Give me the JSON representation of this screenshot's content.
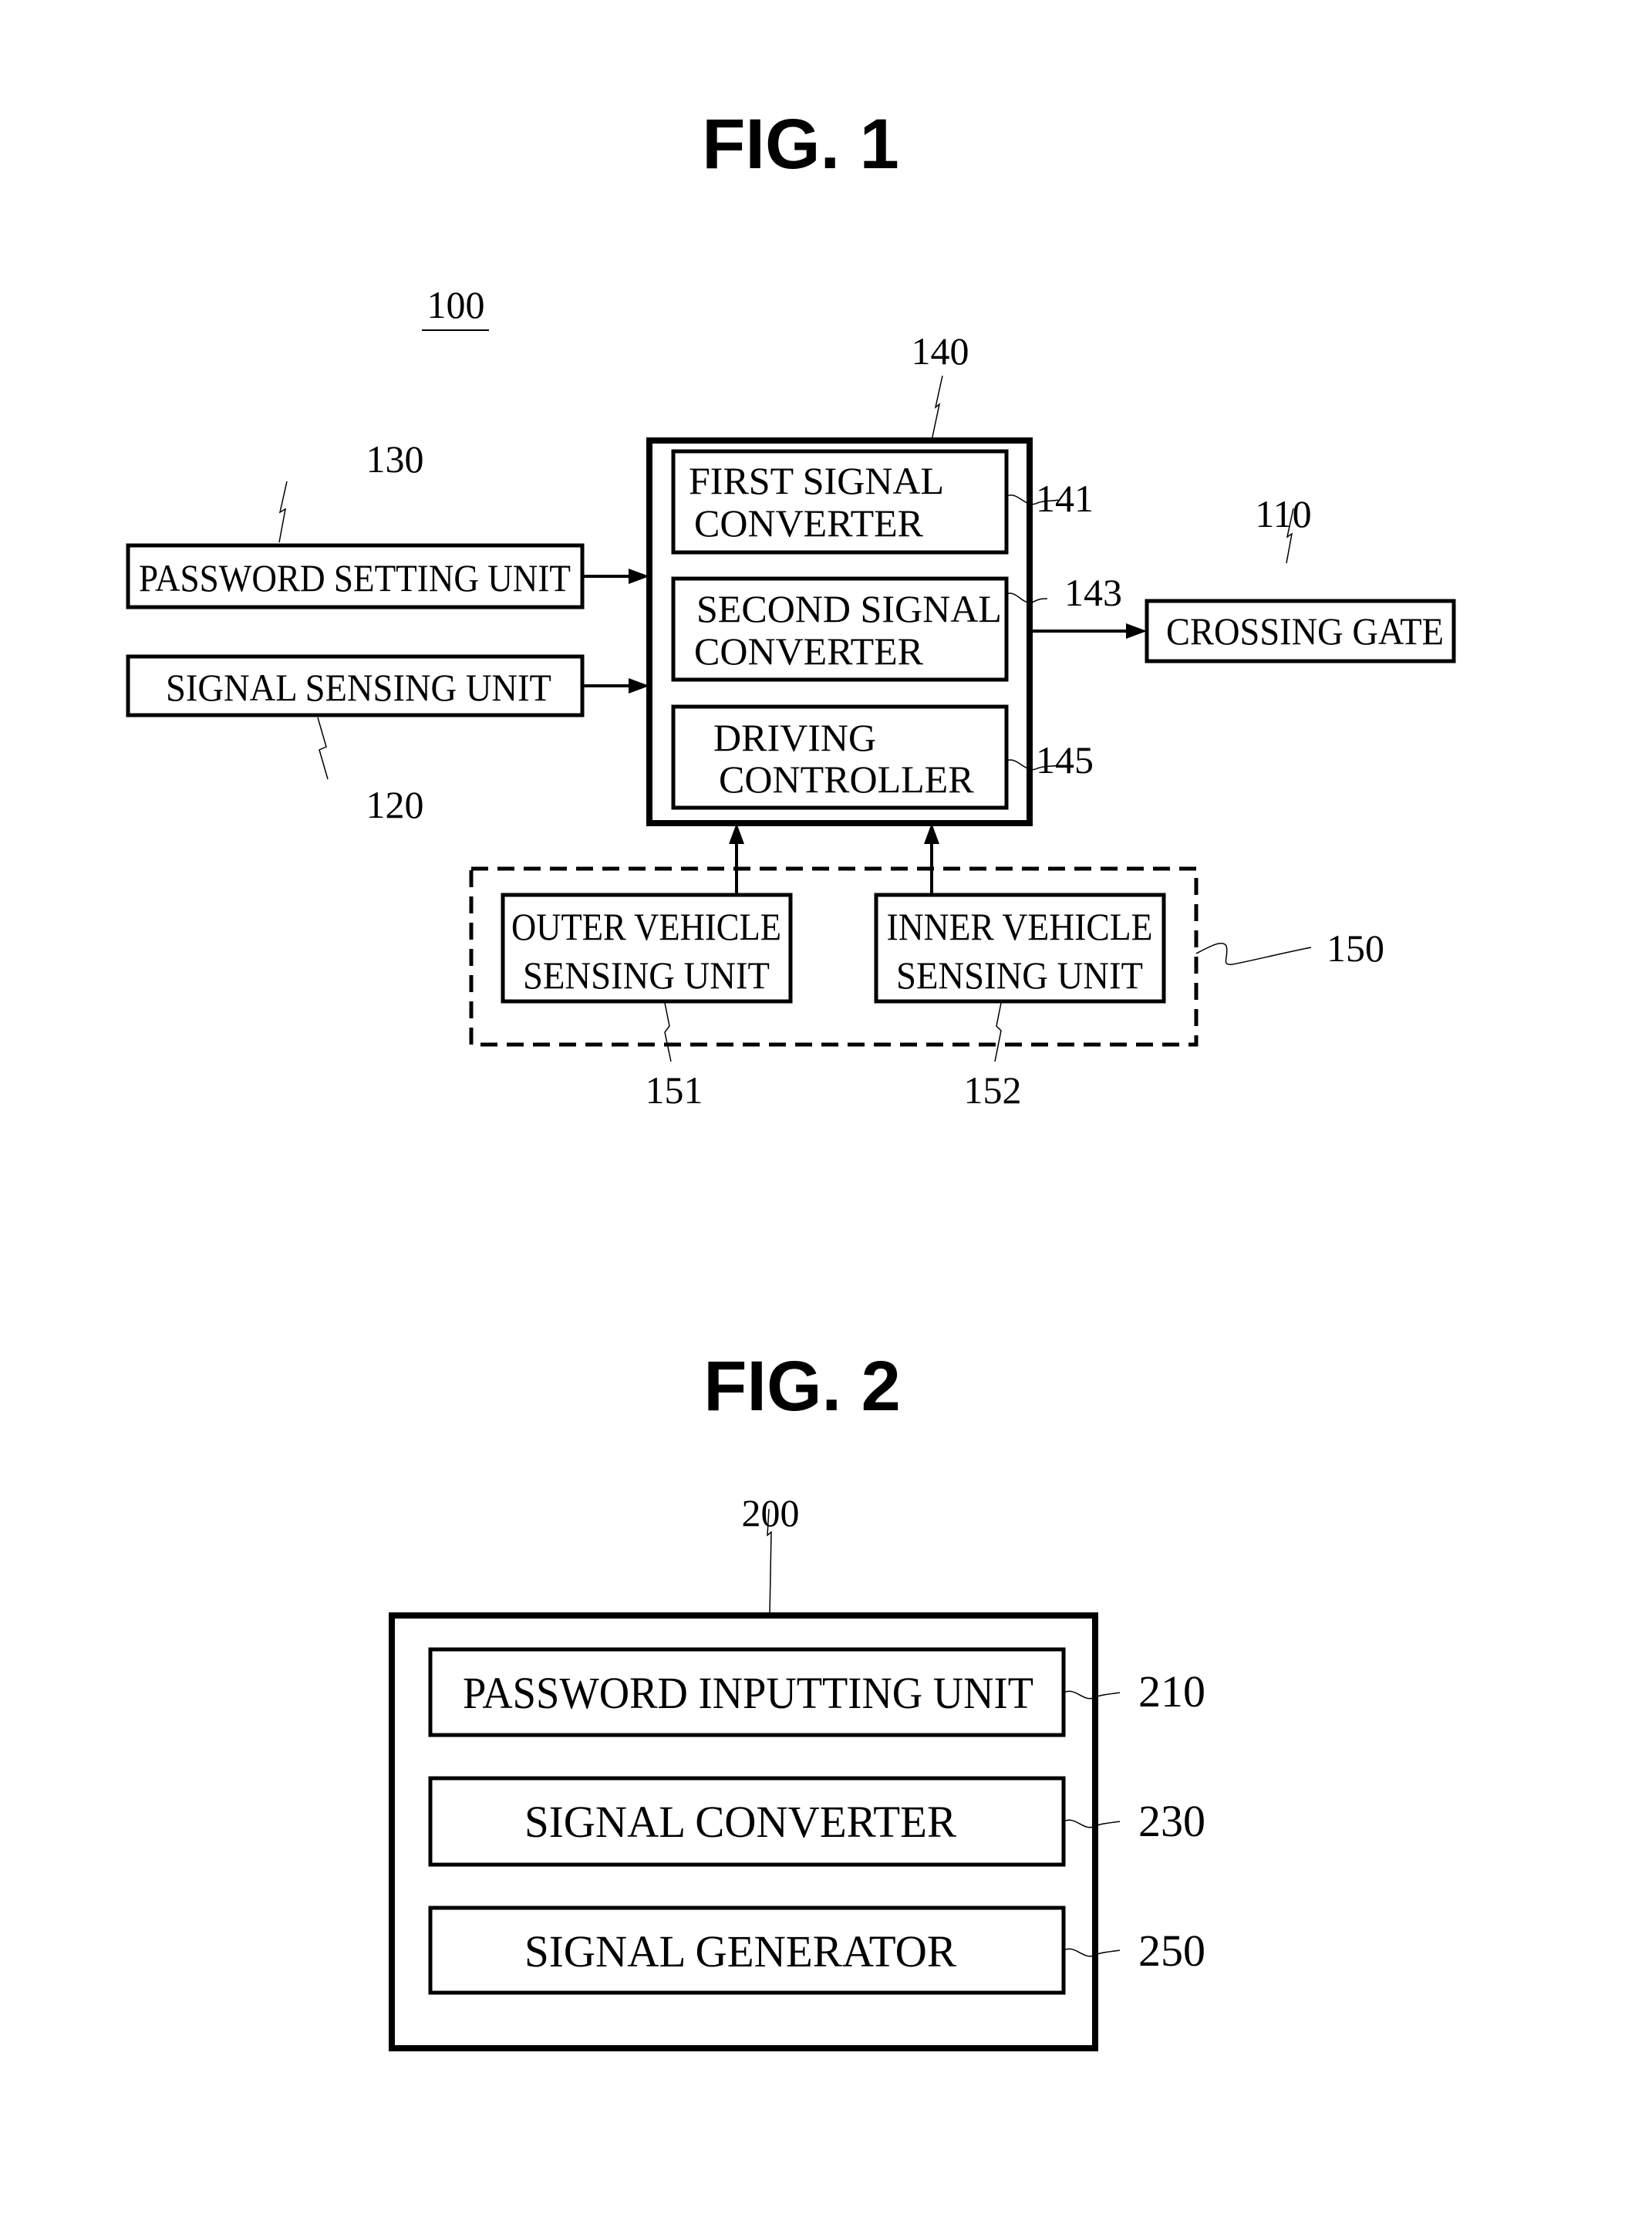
{
  "fig1": {
    "title": "FIG. 1",
    "system_ref": "100",
    "controller": {
      "ref": "140",
      "blocks": [
        {
          "ref": "141",
          "lines": [
            "FIRST SIGNAL",
            "CONVERTER"
          ]
        },
        {
          "ref": "143",
          "lines": [
            "SECOND SIGNAL",
            "CONVERTER"
          ]
        },
        {
          "ref": "145",
          "lines": [
            "DRIVING",
            "CONTROLLER"
          ]
        }
      ]
    },
    "inputs": [
      {
        "ref": "130",
        "label": "PASSWORD SETTING UNIT"
      },
      {
        "ref": "120",
        "label": "SIGNAL SENSING UNIT"
      }
    ],
    "output": {
      "ref": "110",
      "label": "CROSSING GATE"
    },
    "vehicle_sensing_group": {
      "ref": "150",
      "units": [
        {
          "ref": "151",
          "lines": [
            "OUTER VEHICLE",
            "SENSING UNIT"
          ]
        },
        {
          "ref": "152",
          "lines": [
            "INNER VEHICLE",
            "SENSING UNIT"
          ]
        }
      ]
    }
  },
  "fig2": {
    "title": "FIG. 2",
    "device_ref": "200",
    "blocks": [
      {
        "ref": "210",
        "label": "PASSWORD INPUTTING UNIT"
      },
      {
        "ref": "230",
        "label": "SIGNAL CONVERTER"
      },
      {
        "ref": "250",
        "label": "SIGNAL GENERATOR"
      }
    ]
  }
}
